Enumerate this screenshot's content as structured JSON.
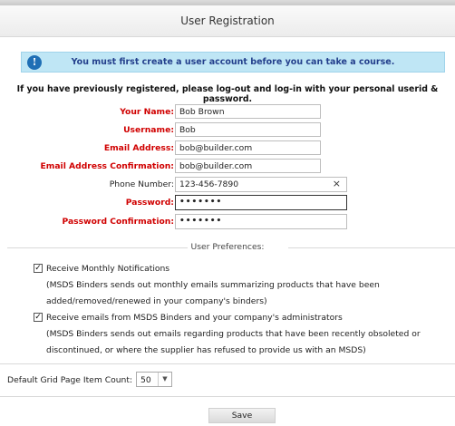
{
  "window": {
    "title": "User Registration"
  },
  "info": {
    "icon": "info-icon",
    "message": "You must first create a user account before you can take a course."
  },
  "notice": "If you have previously registered, please log-out and log-in with your personal userid & password.",
  "form": {
    "your_name": {
      "label": "Your Name:",
      "value": "Bob Brown"
    },
    "username": {
      "label": "Username:",
      "value": "Bob"
    },
    "email": {
      "label": "Email Address:",
      "value": "bob@builder.com"
    },
    "email_confirm": {
      "label": "Email Address Confirmation:",
      "value": "bob@builder.com"
    },
    "phone": {
      "label": "Phone Number:",
      "value": "123-456-7890",
      "clear": "×"
    },
    "password": {
      "label": "Password:",
      "value": "•••••••"
    },
    "password_confirm": {
      "label": "Password Confirmation:",
      "value": "•••••••"
    }
  },
  "preferences": {
    "heading": "User Preferences:",
    "monthly": {
      "checked": true,
      "label": "Receive Monthly Notifications",
      "desc1": "(MSDS Binders sends out monthly emails summarizing products that have been",
      "desc2": "added/removed/renewed in your company's binders)"
    },
    "emails": {
      "checked": true,
      "label": "Receive emails from MSDS Binders and your company's administrators",
      "desc1": "(MSDS Binders sends out emails regarding products that have been recently obsoleted or",
      "desc2": "discontinued, or where the supplier has refused to provide us with an MSDS)"
    }
  },
  "grid": {
    "label": "Default Grid Page Item Count:",
    "value": "50"
  },
  "actions": {
    "save": "Save"
  },
  "colors": {
    "required_label": "#d00000",
    "info_bg": "#bfe6f5",
    "info_text": "#233f8c"
  }
}
